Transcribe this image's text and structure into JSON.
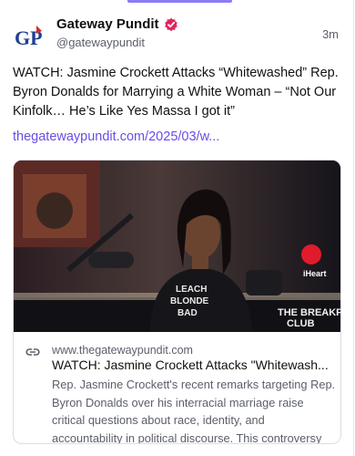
{
  "post": {
    "author_name": "Gateway Pundit",
    "handle": "@gatewaypundit",
    "time": "3m",
    "avatar_text": "GP",
    "text": "WATCH: Jasmine Crockett Attacks “Whitewashed” Rep. Byron Donalds for Marrying a White Woman – “Not Our Kinfolk… He’s Like Yes Massa I got it”",
    "link": "thegatewaypundit.com/2025/03/w...",
    "verified_icon": "verified-badge-icon",
    "accent_color": "#6b4ce6"
  },
  "card": {
    "domain": "www.thegatewaypundit.com",
    "title": "WATCH: Jasmine Crockett Attacks \"Whitewash...",
    "description": "Rep. Jasmine Crockett's recent remarks targeting Rep. Byron Donalds over his interracial marriage raise critical questions about race, identity, and accountability in political discourse. This controversy highlights the do...",
    "image_shirt_text": "LEACH\nBLONDE\nBAD",
    "image_watermark": "THE BREAKFAST CLUB",
    "image_logo": "iHeart",
    "link_icon": "link-icon"
  }
}
